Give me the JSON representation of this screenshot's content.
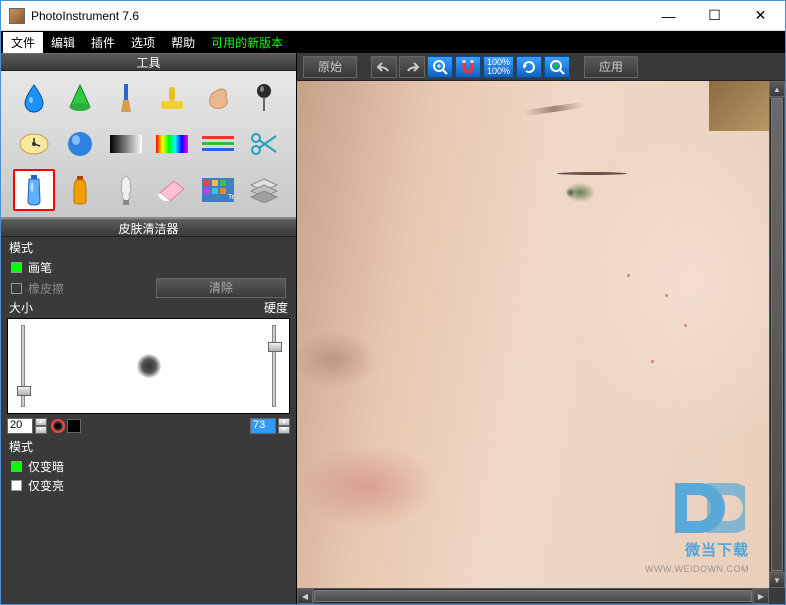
{
  "window": {
    "title": "PhotoInstrument 7.6"
  },
  "menubar": {
    "file": "文件",
    "edit": "编辑",
    "plugins": "插件",
    "options": "选项",
    "help": "帮助",
    "new_version": "可用的新版本"
  },
  "panels": {
    "tools_title": "工具",
    "options_title": "皮肤清洁器"
  },
  "tools": [
    {
      "name": "water-drop-tool"
    },
    {
      "name": "cone-tool"
    },
    {
      "name": "brush-tool"
    },
    {
      "name": "stamp-tool"
    },
    {
      "name": "smudge-tool"
    },
    {
      "name": "pin-tool"
    },
    {
      "name": "clock-tool"
    },
    {
      "name": "sphere-tool"
    },
    {
      "name": "gradient-gray-tool"
    },
    {
      "name": "rainbow-tool"
    },
    {
      "name": "levels-tool"
    },
    {
      "name": "scissors-tool"
    },
    {
      "name": "tube-tool",
      "selected": true
    },
    {
      "name": "bottle-tool"
    },
    {
      "name": "bulb-tool"
    },
    {
      "name": "eraser-tool"
    },
    {
      "name": "mosaic-tool"
    },
    {
      "name": "layers-tool"
    }
  ],
  "options": {
    "mode_label": "模式",
    "brush_label": "画笔",
    "eraser_label": "橡皮擦",
    "clear_label": "清除",
    "size_label": "大小",
    "hardness_label": "硬度",
    "size_value": "20",
    "hardness_value": "73",
    "darken_only": "仅变暗",
    "lighten_only": "仅变亮"
  },
  "toolbar": {
    "original": "原始",
    "apply": "应用",
    "zoom_top": "100%",
    "zoom_bottom": "100%"
  },
  "watermark": {
    "brand": "微当下载",
    "url": "WWW.WEIDOWN.COM"
  }
}
